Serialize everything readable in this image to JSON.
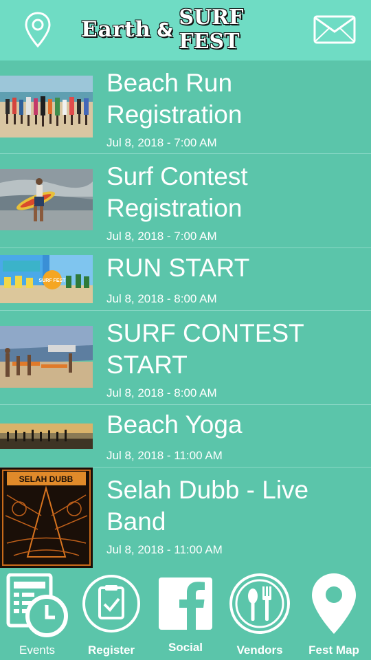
{
  "header": {
    "title_part1": "Earth",
    "title_amp": "&",
    "title_part2": "SURF FEST"
  },
  "events": [
    {
      "title": "Beach Run\nRegistration",
      "date": "Jul 8, 2018 - 7:00 AM"
    },
    {
      "title": "Surf Contest\nRegistration",
      "date": "Jul 8, 2018 - 7:00 AM"
    },
    {
      "title": "RUN START",
      "date": "Jul 8, 2018 - 8:00 AM"
    },
    {
      "title": "SURF CONTEST\nSTART",
      "date": "Jul 8, 2018 - 8:00 AM"
    },
    {
      "title": "Beach Yoga",
      "date": "Jul 8, 2018 - 11:00 AM"
    },
    {
      "title": "Selah Dubb - Live\nBand",
      "date": "Jul 8, 2018 - 11:00 AM"
    }
  ],
  "thumb_texts": {
    "run_start_logo": "SURF FEST",
    "band_poster": "SELAH DUBB"
  },
  "tabs": [
    {
      "label": "Events",
      "icon": "events-calendar-clock-icon"
    },
    {
      "label": "Register",
      "icon": "clipboard-check-icon"
    },
    {
      "label": "Social",
      "icon": "facebook-icon"
    },
    {
      "label": "Vendors",
      "icon": "fork-spoon-icon"
    },
    {
      "label": "Fest Map",
      "icon": "map-pin-icon"
    }
  ],
  "colors": {
    "header_bg": "#6fdcc4",
    "list_bg": "#5bc5aa",
    "text": "#ffffff"
  }
}
